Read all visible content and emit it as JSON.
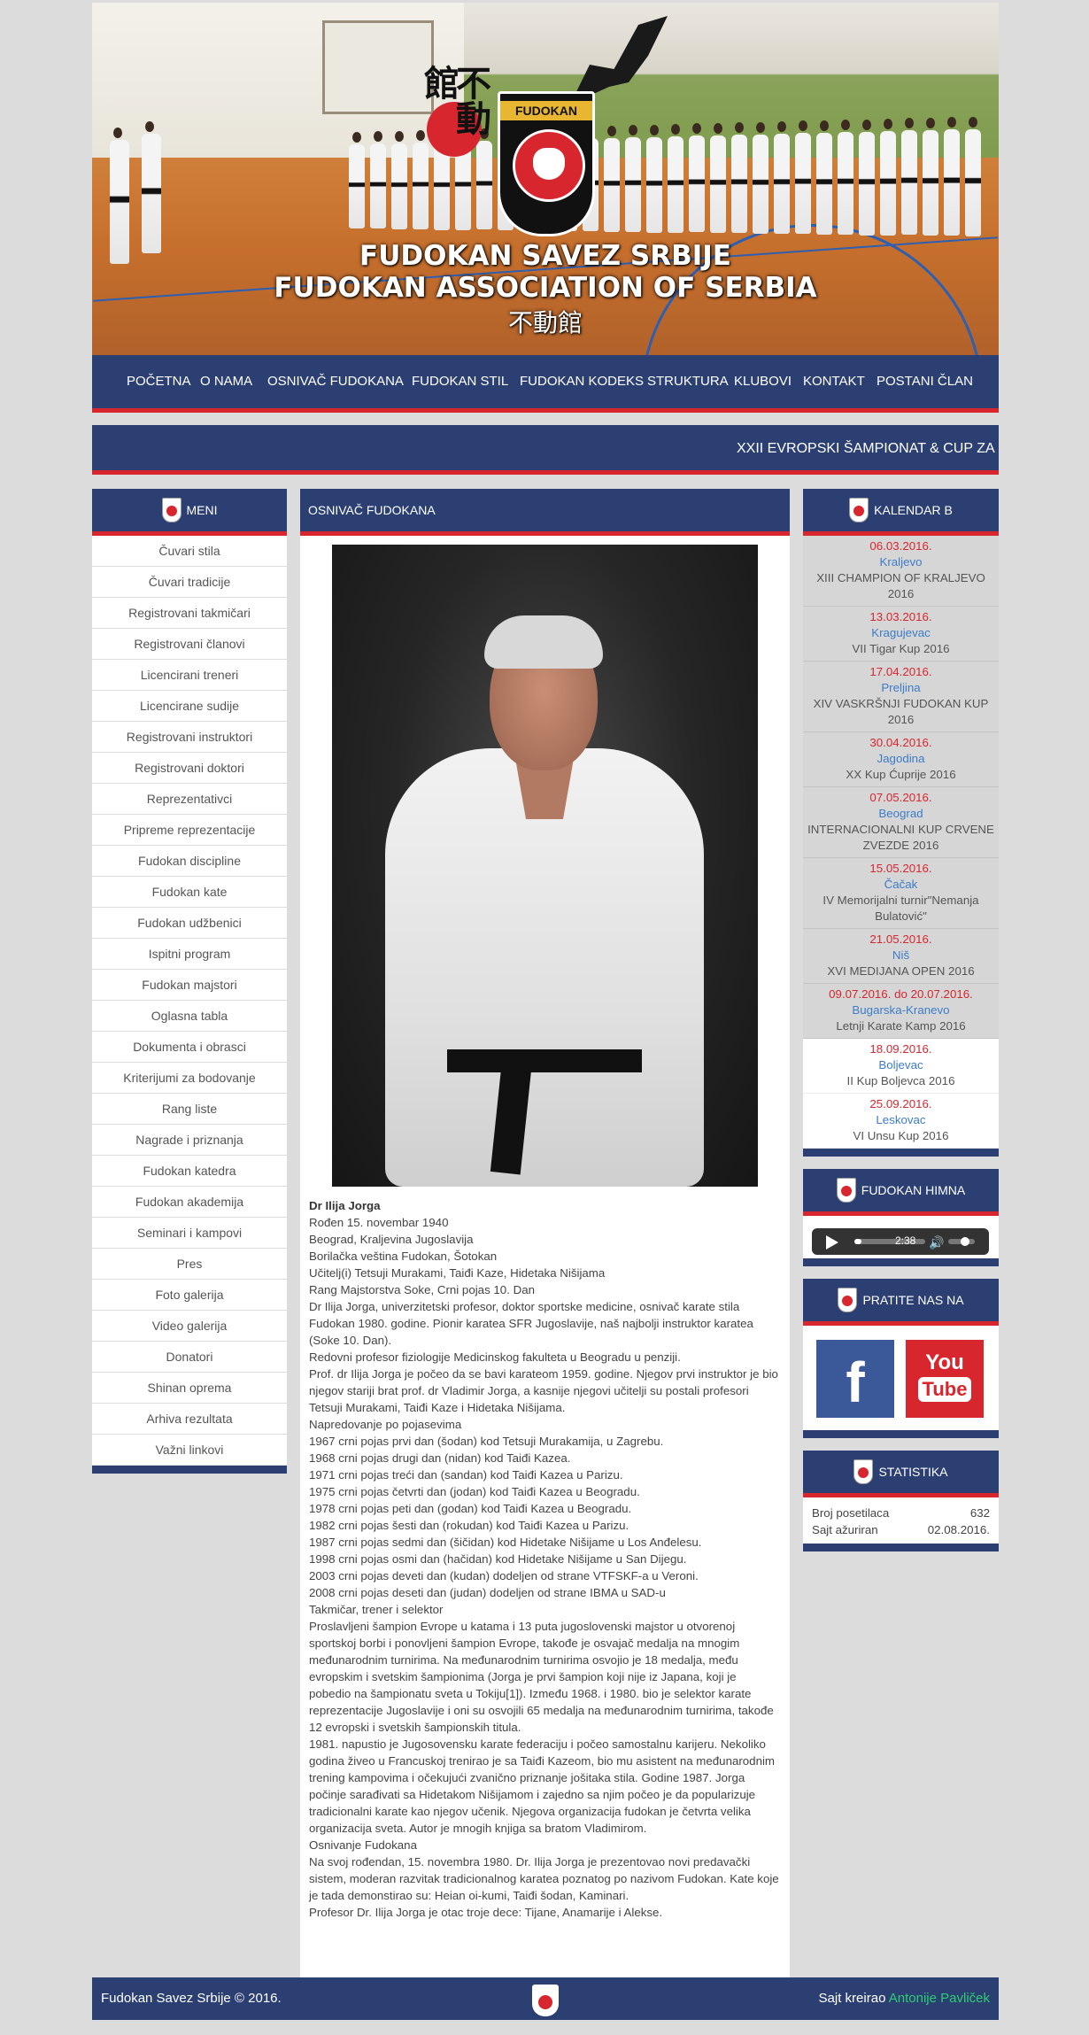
{
  "site": {
    "title_line1": "FUDOKAN SAVEZ SRBIJE",
    "title_line2": "FUDOKAN ASSOCIATION OF SERBIA",
    "title_kanji": "不動館",
    "crest_label": "FUDOKAN"
  },
  "nav": {
    "items": [
      {
        "label": "POČETNA"
      },
      {
        "label": "O NAMA"
      },
      {
        "label": "OSNIVAČ FUDOKANA"
      },
      {
        "label": "FUDOKAN STIL"
      },
      {
        "label": "FUDOKAN KODEKS"
      },
      {
        "label": "STRUKTURA"
      },
      {
        "label": "KLUBOVI"
      },
      {
        "label": "KONTAKT"
      },
      {
        "label": "POSTANI ČLAN"
      }
    ]
  },
  "ticker": {
    "text": "XXII EVROPSKI ŠAMPIONAT & CUP ZA DE"
  },
  "menu": {
    "title": "MENI",
    "items": [
      "Čuvari stila",
      "Čuvari tradicije",
      "Registrovani takmičari",
      "Registrovani članovi",
      "Licencirani treneri",
      "Licencirane sudije",
      "Registrovani instruktori",
      "Registrovani doktori",
      "Reprezentativci",
      "Pripreme reprezentacije",
      "Fudokan discipline",
      "Fudokan kate",
      "Fudokan udžbenici",
      "Ispitni program",
      "Fudokan majstori",
      "Oglasna tabla",
      "Dokumenta i obrasci",
      "Kriterijumi za bodovanje",
      "Rang liste",
      "Nagrade i priznanja",
      "Fudokan katedra",
      "Fudokan akademija",
      "Seminari i kampovi",
      "Pres",
      "Foto galerija",
      "Video galerija",
      "Donatori",
      "Shinan oprema",
      "Arhiva rezultata",
      "Važni linkovi"
    ]
  },
  "article": {
    "title": "OSNIVAČ FUDOKANA",
    "name": "Dr Ilija Jorga",
    "lines": [
      "Rođen 15. novembar 1940",
      "Beograd, Kraljevina Jugoslavija",
      "Borilačka veština Fudokan, Šotokan",
      "Učitelj(i) Tetsuji Murakami, Taiđi Kaze, Hidetaka Nišijama",
      "Rang Majstorstva Soke, Crni pojas 10. Dan",
      "Dr Ilija Jorga, univerzitetski profesor, doktor sportske medicine, osnivač karate stila Fudokan 1980. godine. Pionir karatea SFR Jugoslavije, naš najbolji instruktor karatea (Soke 10. Dan).",
      "Redovni profesor fiziologije Medicinskog fakulteta u Beogradu u penziji.",
      "Prof. dr Ilija Jorga je počeo da se bavi karateom 1959. godine. Njegov prvi instruktor je bio njegov stariji brat prof. dr Vladimir Jorga, a kasnije njegovi učitelji su postali profesori Tetsuji Murakami, Taiđi Kaze i Hidetaka Nišijama.",
      "Napredovanje po pojasevima",
      "1967 crni pojas prvi dan (šodan) kod Tetsuji Murakamija, u Zagrebu.",
      "1968 crni pojas drugi dan (nidan) kod Taiđi Kazea.",
      "1971 crni pojas treći dan (sandan) kod Taiđi Kazea u Parizu.",
      "1975 crni pojas četvrti dan (jodan) kod Taiđi Kazea u Beogradu.",
      "1978 crni pojas peti dan (godan) kod Taiđi Kazea u Beogradu.",
      "1982 crni pojas šesti dan (rokudan) kod Taiđi Kazea u Parizu.",
      "1987 crni pojas sedmi dan (šičidan) kod Hidetake Nišijame u Los Anđelesu.",
      "1998 crni pojas osmi dan (hačidan) kod Hidetake Nišijame u San Dijegu.",
      "2003 crni pojas deveti dan (kudan) dodeljen od strane VTFSKF-a u Veroni.",
      "2008 crni pojas deseti dan (judan) dodeljen od strane IBMA u SAD-u",
      "Takmičar, trener i selektor",
      "Proslavljeni šampion Evrope u katama i 13 puta jugoslovenski majstor u otvorenoj sportskoj borbi i ponovljeni šampion Evrope, takođe je osvajač medalja na mnogim međunarodnim turnirima. Na međunarodnim turnirima osvojio je 18 medalja, među evropskim i svetskim šampionima (Jorga je prvi šampion koji nije iz Japana, koji je pobedio na šampionatu sveta u Tokiju[1]). Između 1968. i 1980. bio je selektor karate reprezentacije Jugoslavije i oni su osvojili 65 medalja na međunarodnim turnirima, takođe 12 evropski i svetskih šampionskih titula.",
      "1981. napustio je Jugosovensku karate federaciju i počeo samostalnu karijeru. Nekoliko godina živeo u Francuskoj trenirao je sa Taiđi Kazeom, bio mu asistent na međunarodnim trening kampovima i očekujući zvanično priznanje jošitaka stila. Godine 1987. Jorga počinje sarađivati sa Hidetakom Nišijamom i zajedno sa njim počeo je da popularizuje tradicionalni karate kao njegov učenik. Njegova organizacija fudokan je četvrta velika organizacija sveta. Autor je mnogih knjiga sa bratom Vladimirom.",
      "Osnivanje Fudokana",
      "Na svoj rođendan, 15. novembra 1980. Dr. Ilija Jorga je prezentovao novi predavački sistem, moderan razvitak tradicionalnog karatea poznatog po nazivom Fudokan. Kate koje je tada demonstirao su: Heian oi-kumi, Taiđi šodan, Kaminari.",
      "Profesor Dr. Ilija Jorga je otac troje dece: Tijane, Anamarije i Alekse."
    ]
  },
  "calendar": {
    "title": "KALENDAR B",
    "events": [
      {
        "date": "06.03.2016.",
        "city": "Kraljevo",
        "name": "XIII CHAMPION OF KRALJEVO 2016",
        "past": true
      },
      {
        "date": "13.03.2016.",
        "city": "Kragujevac",
        "name": "VII Tigar Kup 2016",
        "past": true
      },
      {
        "date": "17.04.2016.",
        "city": "Preljina",
        "name": "XIV VASKRŠNJI FUDOKAN KUP 2016",
        "past": true
      },
      {
        "date": "30.04.2016.",
        "city": "Jagodina",
        "name": "XX Kup Ćuprije 2016",
        "past": true
      },
      {
        "date": "07.05.2016.",
        "city": "Beograd",
        "name": "INTERNACIONALNI KUP CRVENE ZVEZDE 2016",
        "past": true
      },
      {
        "date": "15.05.2016.",
        "city": "Čačak",
        "name": "IV Memorijalni turnir\"Nemanja Bulatović\"",
        "past": true
      },
      {
        "date": "21.05.2016.",
        "city": "Niš",
        "name": "XVI MEDIJANA OPEN 2016",
        "past": true
      },
      {
        "date": "09.07.2016. do 20.07.2016.",
        "city": "Bugarska-Kranevo",
        "name": "Letnji Karate Kamp 2016",
        "past": true
      },
      {
        "date": "18.09.2016.",
        "city": "Boljevac",
        "name": "II Kup Boljevca 2016",
        "past": false
      },
      {
        "date": "25.09.2016.",
        "city": "Leskovac",
        "name": "VI Unsu Kup 2016",
        "past": false
      }
    ]
  },
  "anthem": {
    "title": "FUDOKAN HIMNA",
    "time": "2:38",
    "progress": 0.1
  },
  "follow": {
    "title": "PRATITE NAS NA",
    "facebook": "f",
    "youtube_you": "You",
    "youtube_tube": "Tube"
  },
  "stats": {
    "title": "STATISTIKA",
    "visitors_label": "Broj posetilaca",
    "visitors_value": "632",
    "updated_label": "Sajt ažuriran",
    "updated_value": "02.08.2016."
  },
  "footer": {
    "copyright": "Fudokan Savez Srbije © 2016.",
    "credit_prefix": "Sajt kreirao",
    "credit_name": "Antonije Pavliček"
  },
  "colors": {
    "navy": "#2b3f73",
    "red": "#d8262e",
    "link": "#3d7cc9",
    "credit": "#2ecc71"
  },
  "icons": [
    "fudokan-crest-icon",
    "play-icon",
    "volume-icon",
    "facebook-icon",
    "youtube-icon"
  ]
}
